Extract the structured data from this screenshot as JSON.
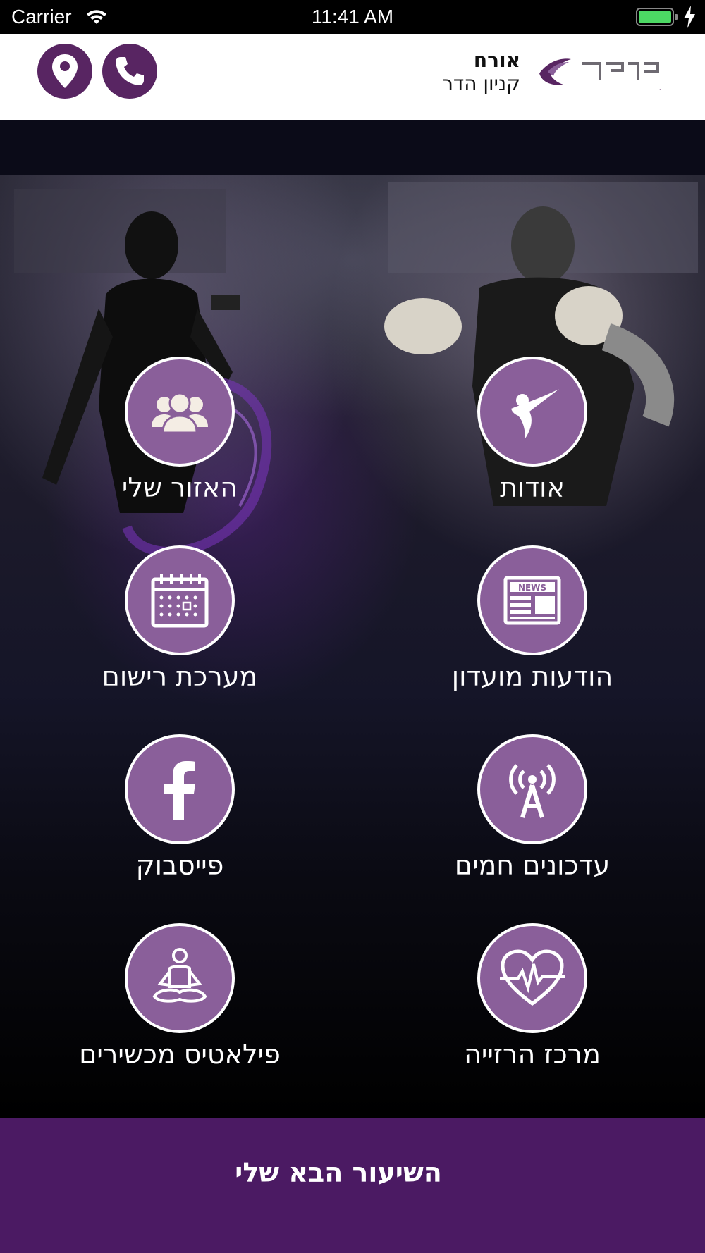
{
  "status_bar": {
    "carrier": "Carrier",
    "time": "11:41 AM",
    "wifi_icon": "wifi-icon",
    "battery_icon": "battery-full-icon",
    "battery_color": "#4cd964"
  },
  "header": {
    "user_name": "אורח",
    "branch": "קניון הדר",
    "logo_text": "מועדוני כושר",
    "location_icon": "map-pin-icon",
    "phone_icon": "phone-icon",
    "accent_color": "#582562"
  },
  "menu": {
    "about": {
      "label": "אודות",
      "icon": "kick-figure-icon"
    },
    "my_area": {
      "label": "האזור שלי",
      "icon": "users-group-icon"
    },
    "club_news": {
      "label": "הודעות מועדון",
      "icon": "newspaper-icon"
    },
    "registration": {
      "label": "מערכת רישום",
      "icon": "calendar-icon"
    },
    "live_updates": {
      "label": "עדכונים חמים",
      "icon": "broadcast-tower-icon"
    },
    "facebook": {
      "label": "פייסבוק",
      "icon": "facebook-icon"
    },
    "running_center": {
      "label": "מרכז הרזייה",
      "icon": "heart-pulse-icon"
    },
    "pilates": {
      "label": "פילאטיס מכשירים",
      "icon": "meditation-icon"
    },
    "circle_color": "#8a5f9a"
  },
  "footer": {
    "next_class_label": "השיעור הבא שלי",
    "bar_color": "#4b1a63"
  }
}
